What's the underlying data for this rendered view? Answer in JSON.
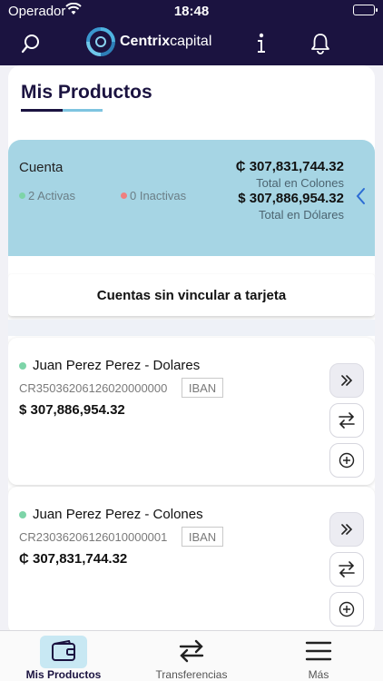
{
  "status_bar": {
    "carrier": "Operador",
    "time": "18:48"
  },
  "header": {
    "brand_strong": "Centrix",
    "brand_light": "capital"
  },
  "page": {
    "title": "Mis Productos"
  },
  "summary": {
    "label": "Cuenta",
    "active": "2 Activas",
    "inactive": "0 Inactivas",
    "colones_amount": "₵ 307,831,744.32",
    "colones_label": "Total en Colones",
    "dollars_amount": "$ 307,886,954.32",
    "dollars_label": "Total en Dólares",
    "active_color": "#7dd4a8",
    "inactive_color": "#ef7f7f"
  },
  "unlinked": {
    "label": "Cuentas sin vincular a tarjeta"
  },
  "accounts": [
    {
      "name": "Juan Perez Perez - Dolares",
      "iban": "CR35036206126020000000",
      "iban_tag": "IBAN",
      "balance": "$ 307,886,954.32"
    },
    {
      "name": "Juan Perez Perez - Colones",
      "iban": "CR23036206126010000001",
      "iban_tag": "IBAN",
      "balance": "₵ 307,831,744.32"
    }
  ],
  "tabs": [
    {
      "label": "Mis Productos",
      "icon": "wallet-icon",
      "active": true
    },
    {
      "label": "Transferencias",
      "icon": "transfer-icon",
      "active": false
    },
    {
      "label": "Más",
      "icon": "menu-icon",
      "active": false
    }
  ],
  "colors": {
    "header": "#1b1340",
    "accent": "#a6d5e4",
    "tab_active_bg": "#c8e8f3"
  }
}
